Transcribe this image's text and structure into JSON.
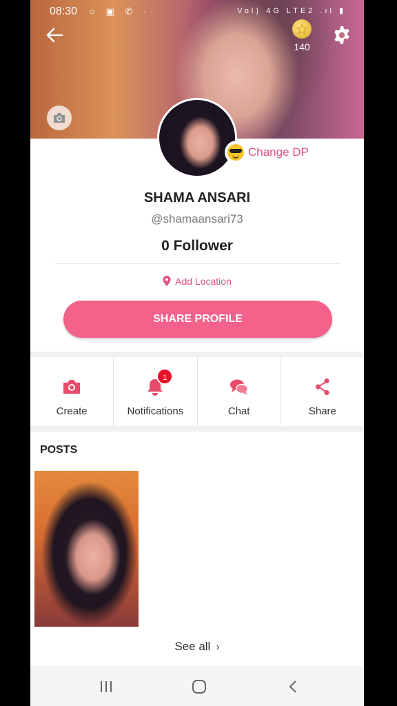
{
  "status_bar": {
    "time": "08:30",
    "left_icons": "○ ▣ ✆ ··",
    "right_icons": "Vol) 4G LTE2 .ıl ▮"
  },
  "header": {
    "coins": "140"
  },
  "profile": {
    "change_dp_label": "Change DP",
    "name": "SHAMA ANSARI",
    "handle": "@shamaansari73",
    "followers": "0 Follower",
    "location_label": "Add Location",
    "share_profile_label": "SHARE PROFILE"
  },
  "actions": [
    {
      "label": "Create",
      "icon": "camera-icon"
    },
    {
      "label": "Notifications",
      "icon": "bell-icon",
      "badge": "1"
    },
    {
      "label": "Chat",
      "icon": "chat-icon"
    },
    {
      "label": "Share",
      "icon": "share-icon"
    }
  ],
  "posts": {
    "title": "POSTS",
    "see_all_label": "See all",
    "chevron": "›"
  },
  "colors": {
    "accent": "#f2628a",
    "accent_text": "#e0527a",
    "badge": "#e8132a"
  }
}
